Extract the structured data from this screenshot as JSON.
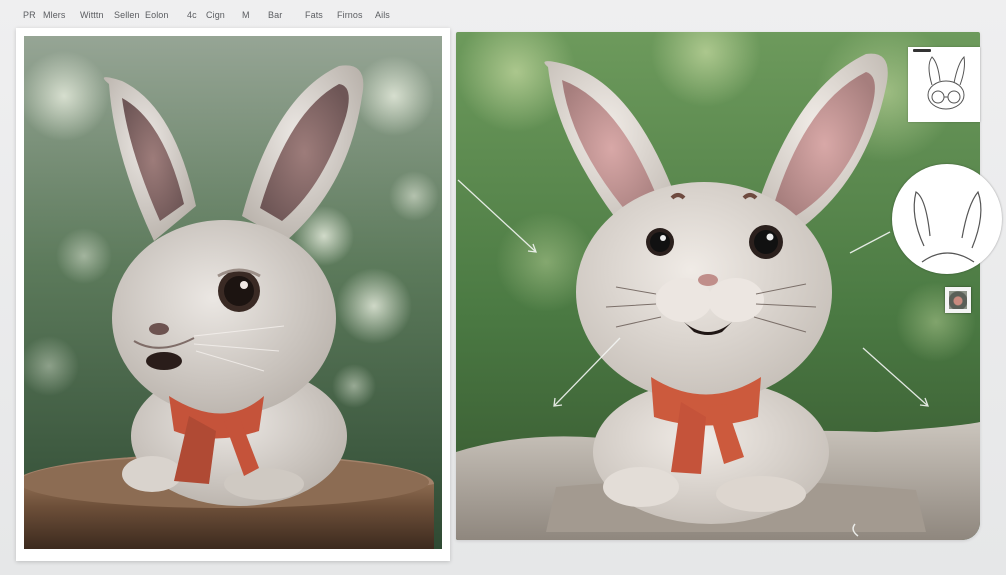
{
  "menu": {
    "items": [
      "PR",
      "Mlers",
      "Witttn",
      "Sellen",
      "Eolon",
      "4c",
      "Cign",
      "M",
      "Bar",
      "Fats",
      "Firnos",
      "Ails"
    ]
  },
  "colors": {
    "background": "#ebebec",
    "card": "#ffffff",
    "menu_text": "#5b5d61",
    "scarf": "#c5533a",
    "fur": "#dcd7d2",
    "foliage": "#4f7a45"
  },
  "icons": {
    "side_panel": [
      "rabbit-sketch-thumbnail-icon",
      "ears-outline-icon",
      "photo-thumbnail-icon"
    ]
  }
}
